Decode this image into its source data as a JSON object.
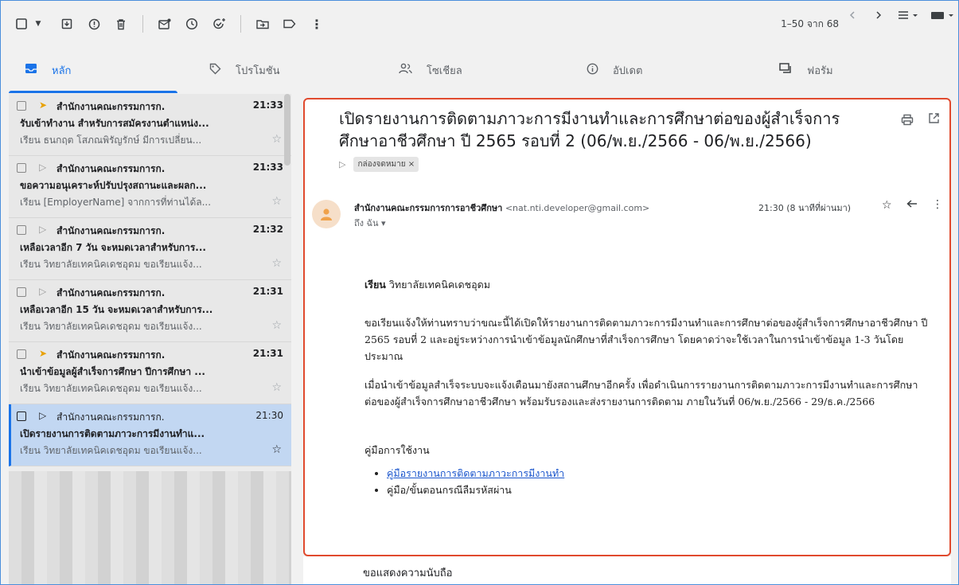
{
  "toolbar": {
    "icons": [
      "checkbox-icon",
      "dropdown-arrow-icon",
      "archive-icon",
      "report-spam-icon",
      "delete-icon",
      "mark-unread-icon",
      "snooze-icon",
      "add-task-icon",
      "move-to-icon",
      "label-icon",
      "more-icon"
    ],
    "pager": "1–50 จาก 68"
  },
  "tabs": [
    {
      "label": "หลัก",
      "icon": "inbox-icon"
    },
    {
      "label": "โปรโมชัน",
      "icon": "tag-icon"
    },
    {
      "label": "โซเชียล",
      "icon": "people-icon"
    },
    {
      "label": "อัปเดต",
      "icon": "info-icon"
    },
    {
      "label": "ฟอรัม",
      "icon": "forum-icon"
    }
  ],
  "list": [
    {
      "sender": "สำนักงานคณะกรรมการก.",
      "time": "21:33",
      "subject": "รับเข้าทำงาน สำหรับการสมัครงานตำแหน่ง...",
      "snippet": "เรียน ธนกฤต โสภณพิรัญรักษ์ มีการเปลี่ยน...",
      "important": true
    },
    {
      "sender": "สำนักงานคณะกรรมการก.",
      "time": "21:33",
      "subject": "ขอความอนุเคราะห์ปรับปรุงสถานะและผลก...",
      "snippet": "เรียน [EmployerName] จากการที่ท่านได้ล...",
      "important": false
    },
    {
      "sender": "สำนักงานคณะกรรมการก.",
      "time": "21:32",
      "subject": "เหลือเวลาอีก 7 วัน จะหมดเวลาสำหรับการ...",
      "snippet": "เรียน วิทยาลัยเทคนิคเดชอุดม ขอเรียนแจ้ง...",
      "important": false
    },
    {
      "sender": "สำนักงานคณะกรรมการก.",
      "time": "21:31",
      "subject": "เหลือเวลาอีก 15 วัน จะหมดเวลาสำหรับการ...",
      "snippet": "เรียน วิทยาลัยเทคนิคเดชอุดม ขอเรียนแจ้ง...",
      "important": false
    },
    {
      "sender": "สำนักงานคณะกรรมการก.",
      "time": "21:31",
      "subject": "นำเข้าข้อมูลผู้สำเร็จการศึกษา ปีการศึกษา ...",
      "snippet": "เรียน วิทยาลัยเทคนิคเดชอุดม ขอเรียนแจ้ง...",
      "important": true
    },
    {
      "sender": "สำนักงานคณะกรรมการก.",
      "time": "21:30",
      "subject": "เปิดรายงานการติดตามภาวะการมีงานทำแ...",
      "snippet": "เรียน วิทยาลัยเทคนิคเดชอุดม ขอเรียนแจ้ง...",
      "important": false
    }
  ],
  "message": {
    "subject": "เปิดรายงานการติดตามภาวะการมีงานทำและการศึกษาต่อของผู้สำเร็จการศึกษาอาชีวศึกษา ปี 2565 รอบที่ 2 (06/พ.ย./2566 - 06/พ.ย./2566)",
    "label": "กล่องจดหมาย ×",
    "from_name": "สำนักงานคณะกรรมการการอาชีวศึกษา",
    "from_email": "<nat.nti.developer@gmail.com>",
    "to": "ถึง ฉัน ▾",
    "time": "21:30 (8 นาทีที่ผ่านมา)",
    "greeting_bold": "เรียน",
    "greeting_rest": " วิทยาลัยเทคนิคเดชอุดม",
    "para1": "ขอเรียนแจ้งให้ท่านทราบว่าขณะนี้ได้เปิดให้รายงานการติดตามภาวะการมีงานทำและการศึกษาต่อของผู้สำเร็จการศึกษาอาชีวศึกษา ปี 2565 รอบที่ 2 และอยู่ระหว่างการนำเข้าข้อมูลนักศึกษาที่สำเร็จการศึกษา โดยคาดว่าจะใช้เวลาในการนำเข้าข้อมูล 1-3 วันโดยประมาณ",
    "para2": "เมื่อนำเข้าข้อมูลสำเร็จระบบจะแจ้งเตือนมายังสถานศึกษาอีกครั้ง เพื่อดำเนินการรายงานการติดตามภาวะการมีงานทำและการศึกษาต่อของผู้สำเร็จการศึกษาอาชีวศึกษา พร้อมรับรองและส่งรายงานการติดตาม ภายในวันที่ 06/พ.ย./2566 - 29/ธ.ค./2566",
    "manual_heading": "คู่มือการใช้งาน",
    "manual_link": "คู่มือรายงานการติดตามภาวะการมีงานทำ",
    "manual_item2": "คู่มือ/ขั้นตอนกรณีลืมรหัสผ่าน",
    "closing": "ขอแสดงความนับถือ"
  }
}
